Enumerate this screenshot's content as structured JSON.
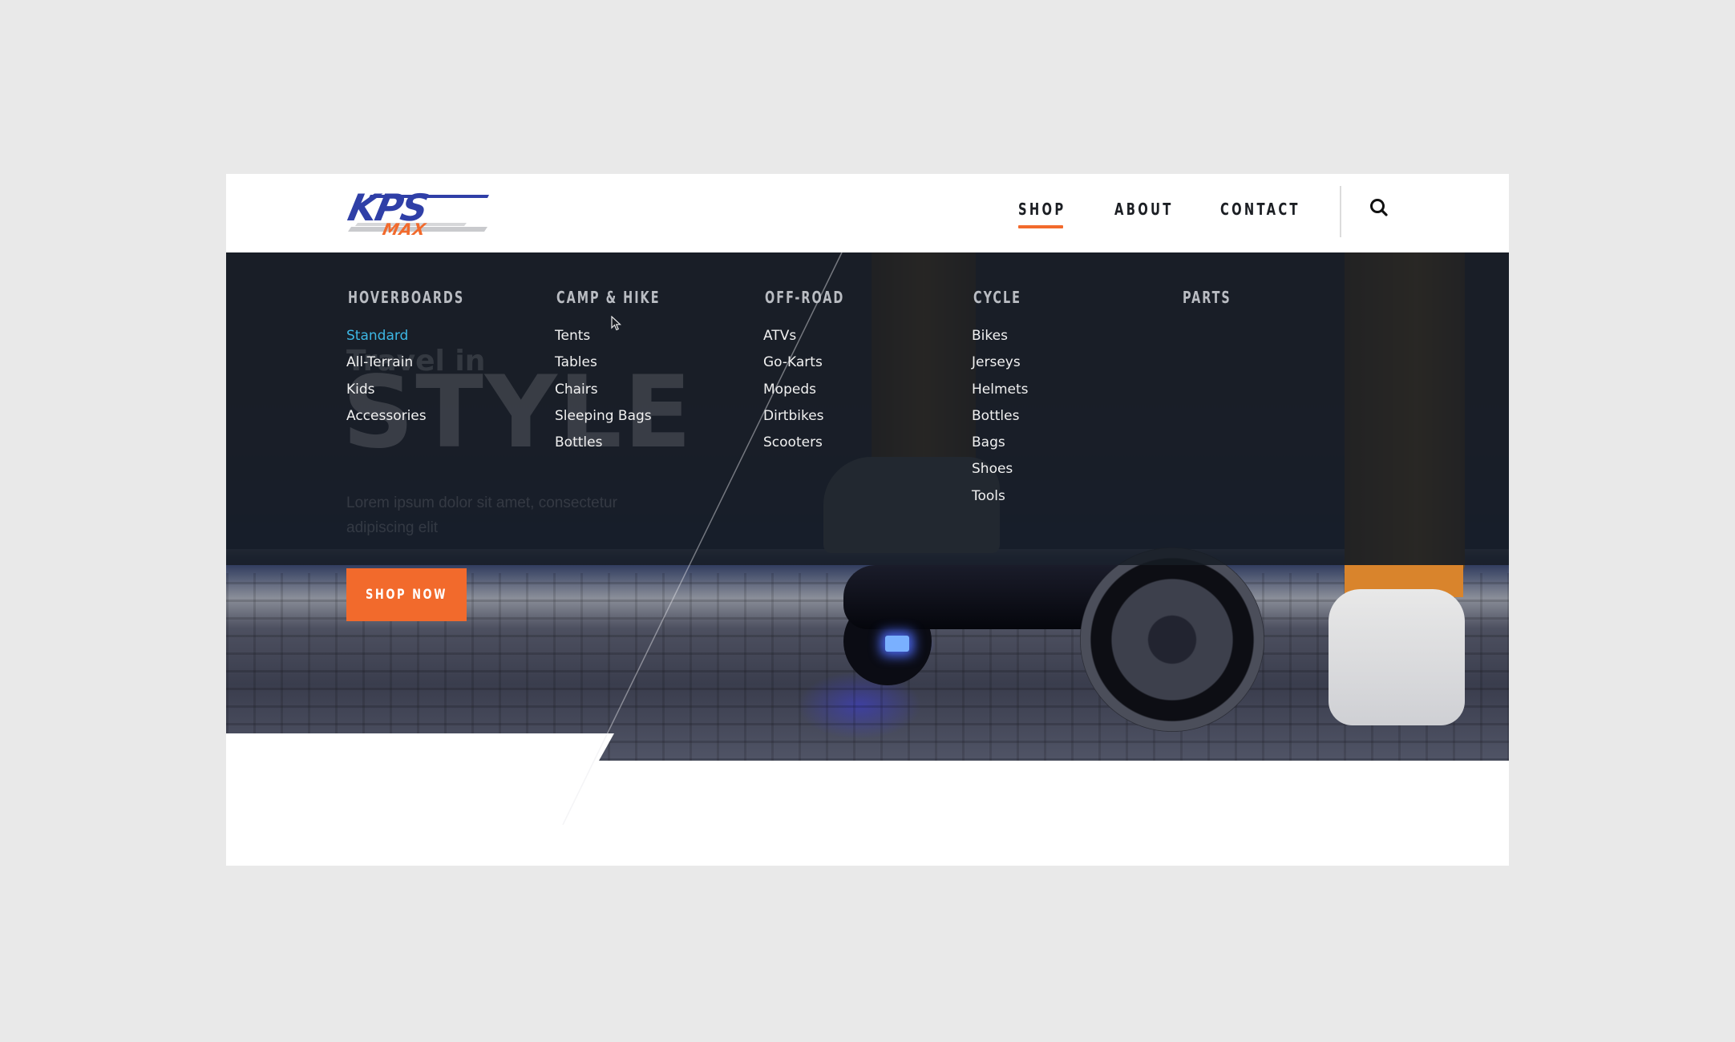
{
  "brand": {
    "logo_text": "KPS",
    "logo_subtext": "MAX",
    "colors": {
      "logo_blue": "#2f3fa7",
      "accent_orange": "#f26a2c",
      "active_link": "#3db7e4",
      "nav_text": "#1c1f24"
    }
  },
  "nav": {
    "items": [
      {
        "label": "SHOP",
        "active": true
      },
      {
        "label": "ABOUT",
        "active": false
      },
      {
        "label": "CONTACT",
        "active": false
      }
    ],
    "search_icon": "search-icon"
  },
  "hero": {
    "eyebrow": "Travel in",
    "headline": "STYLE",
    "body": "Lorem ipsum dolor sit amet, consectetur adipiscing elit",
    "cta_label": "SHOP NOW"
  },
  "mega_menu": {
    "columns": [
      {
        "heading": "HOVERBOARDS",
        "items": [
          "Standard",
          "All-Terrain",
          "Kids",
          "Accessories"
        ],
        "active_item": "Standard"
      },
      {
        "heading": "CAMP & HIKE",
        "items": [
          "Tents",
          "Tables",
          "Chairs",
          "Sleeping Bags",
          "Bottles"
        ]
      },
      {
        "heading": "OFF-ROAD",
        "items": [
          "ATVs",
          "Go-Karts",
          "Mopeds",
          "Dirtbikes",
          "Scooters"
        ]
      },
      {
        "heading": "CYCLE",
        "items": [
          "Bikes",
          "Jerseys",
          "Helmets",
          "Bottles",
          "Bags",
          "Shoes",
          "Tools"
        ]
      },
      {
        "heading": "PARTS",
        "items": []
      }
    ]
  }
}
